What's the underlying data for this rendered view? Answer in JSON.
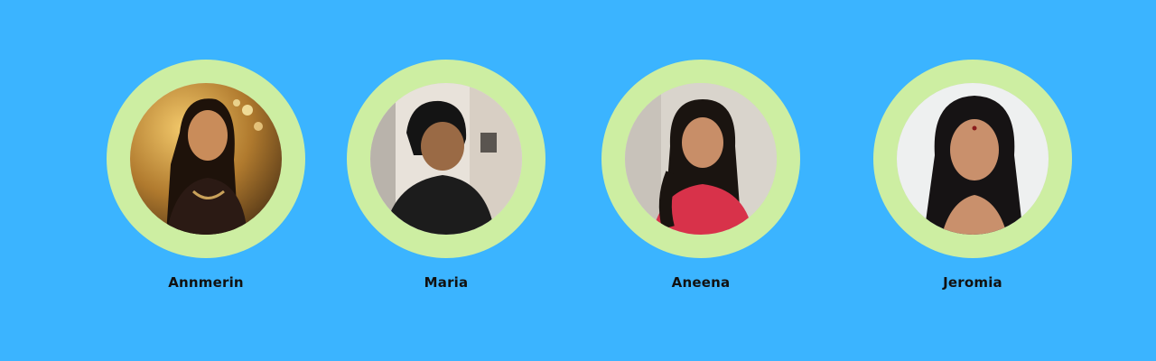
{
  "colors": {
    "background": "#3bb4ff",
    "ring": "#cdeea2",
    "name_text": "#111111"
  },
  "team": [
    {
      "name": "Annmerin",
      "icon": "person-photo"
    },
    {
      "name": "Maria",
      "icon": "person-photo"
    },
    {
      "name": "Aneena",
      "icon": "person-photo"
    },
    {
      "name": "Jeromia",
      "icon": "person-photo"
    }
  ]
}
